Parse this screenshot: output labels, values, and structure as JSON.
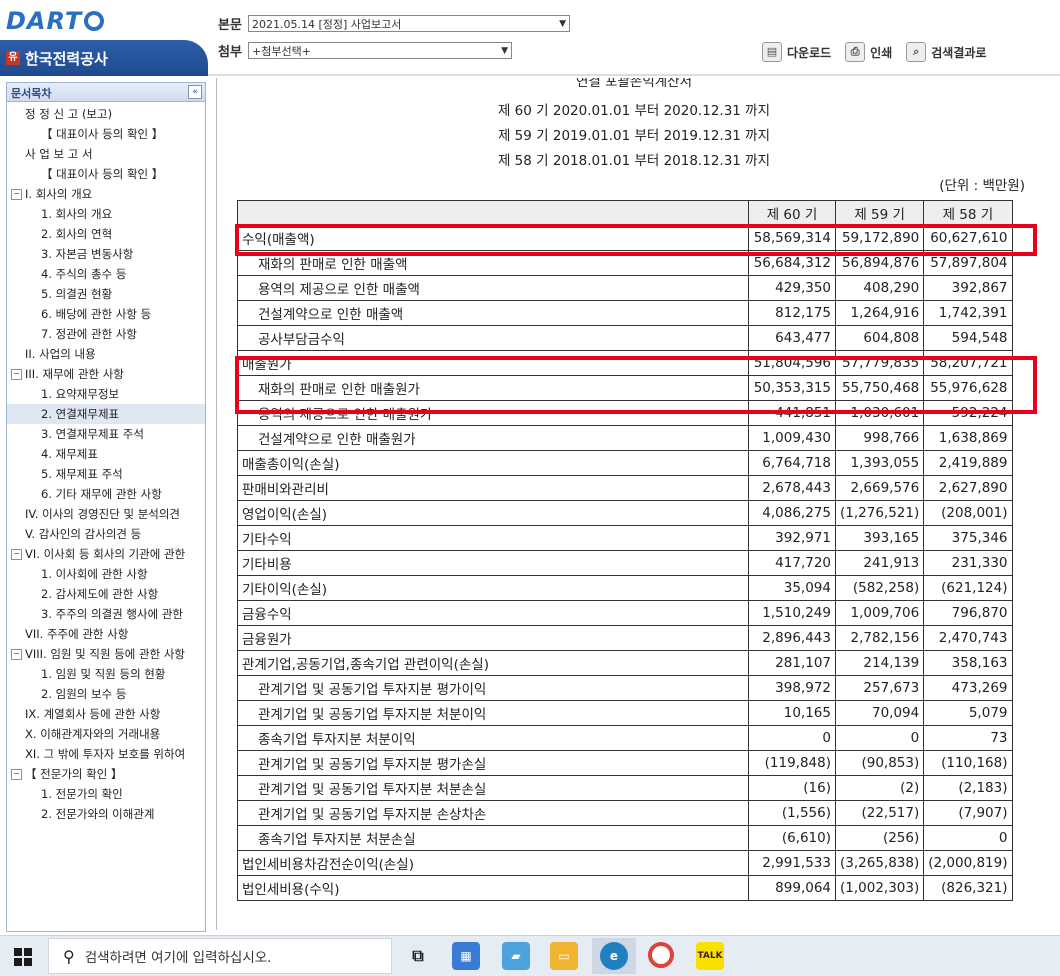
{
  "header": {
    "logo": "DART",
    "company": "한국전력공사",
    "main_label": "본문",
    "main_value": "2021.05.14 [정정] 사업보고서",
    "attach_label": "첨부",
    "attach_value": "+첨부선택+",
    "toolbar": {
      "download": "다운로드",
      "print": "인쇄",
      "search_result": "검색결과로"
    }
  },
  "sidebar": {
    "title": "문서목차",
    "items": [
      {
        "label": "정 정 신 고 (보고)",
        "level": "s"
      },
      {
        "label": "【 대표이사 등의 확인 】",
        "level": "1"
      },
      {
        "label": "사 업 보 고 서",
        "level": "s"
      },
      {
        "label": "【 대표이사 등의 확인 】",
        "level": "1"
      },
      {
        "label": "I. 회사의 개요",
        "level": "0"
      },
      {
        "label": "1. 회사의 개요",
        "level": "1"
      },
      {
        "label": "2. 회사의 연혁",
        "level": "1"
      },
      {
        "label": "3. 자본금 변동사항",
        "level": "1"
      },
      {
        "label": "4. 주식의 총수 등",
        "level": "1"
      },
      {
        "label": "5. 의결권 현황",
        "level": "1"
      },
      {
        "label": "6. 배당에 관한 사항 등",
        "level": "1"
      },
      {
        "label": "7. 정관에 관한 사항",
        "level": "1"
      },
      {
        "label": "II. 사업의 내용",
        "level": "s"
      },
      {
        "label": "III. 재무에 관한 사항",
        "level": "0"
      },
      {
        "label": "1. 요약재무정보",
        "level": "1"
      },
      {
        "label": "2. 연결재무제표",
        "level": "1"
      },
      {
        "label": "3. 연결재무제표 주석",
        "level": "1"
      },
      {
        "label": "4. 재무제표",
        "level": "1"
      },
      {
        "label": "5. 재무제표 주석",
        "level": "1"
      },
      {
        "label": "6. 기타 재무에 관한 사항",
        "level": "1"
      },
      {
        "label": "IV. 이사의 경영진단 및 분석의견",
        "level": "s"
      },
      {
        "label": "V. 감사인의 감사의견 등",
        "level": "s"
      },
      {
        "label": "VI. 이사회 등 회사의 기관에 관한",
        "level": "0"
      },
      {
        "label": "1. 이사회에 관한 사항",
        "level": "1"
      },
      {
        "label": "2. 감사제도에 관한 사항",
        "level": "1"
      },
      {
        "label": "3. 주주의 의결권 행사에 관한",
        "level": "1"
      },
      {
        "label": "VII. 주주에 관한 사항",
        "level": "s"
      },
      {
        "label": "VIII. 임원 및 직원 등에 관한 사항",
        "level": "0"
      },
      {
        "label": "1. 임원 및 직원 등의 현황",
        "level": "1"
      },
      {
        "label": "2. 임원의 보수 등",
        "level": "1"
      },
      {
        "label": "IX. 계열회사 등에 관한 사항",
        "level": "s"
      },
      {
        "label": "X. 이해관계자와의 거래내용",
        "level": "s"
      },
      {
        "label": "XI. 그 밖에 투자자 보호를 위하여",
        "level": "s"
      },
      {
        "label": "【 전문가의 확인 】",
        "level": "0"
      },
      {
        "label": "1. 전문가의 확인",
        "level": "1"
      },
      {
        "label": "2. 전문가와의 이해관계",
        "level": "1"
      }
    ]
  },
  "statement": {
    "title_partial": "연결 포괄손익계산서",
    "periods": [
      "제 60 기 2020.01.01 부터 2020.12.31 까지",
      "제 59 기 2019.01.01 부터 2019.12.31 까지",
      "제 58 기 2018.01.01 부터 2018.12.31 까지"
    ],
    "unit": "(단위 : 백만원)",
    "columns": [
      "",
      "제 60 기",
      "제 59 기",
      "제 58 기"
    ],
    "rows": [
      {
        "label": "수익(매출액)",
        "indent": false,
        "v": [
          "58,569,314",
          "59,172,890",
          "60,627,610"
        ]
      },
      {
        "label": "재화의 판매로 인한 매출액",
        "indent": true,
        "v": [
          "56,684,312",
          "56,894,876",
          "57,897,804"
        ]
      },
      {
        "label": "용역의 제공으로 인한 매출액",
        "indent": true,
        "v": [
          "429,350",
          "408,290",
          "392,867"
        ]
      },
      {
        "label": "건설계약으로 인한 매출액",
        "indent": true,
        "v": [
          "812,175",
          "1,264,916",
          "1,742,391"
        ]
      },
      {
        "label": "공사부담금수익",
        "indent": true,
        "v": [
          "643,477",
          "604,808",
          "594,548"
        ]
      },
      {
        "label": "매출원가",
        "indent": false,
        "v": [
          "51,804,596",
          "57,779,835",
          "58,207,721"
        ]
      },
      {
        "label": "재화의 판매로 인한 매출원가",
        "indent": true,
        "v": [
          "50,353,315",
          "55,750,468",
          "55,976,628"
        ]
      },
      {
        "label": "용역의 제공으로 인한 매출원가",
        "indent": true,
        "v": [
          "441,851",
          "1,030,601",
          "592,224"
        ]
      },
      {
        "label": "건설계약으로 인한 매출원가",
        "indent": true,
        "v": [
          "1,009,430",
          "998,766",
          "1,638,869"
        ]
      },
      {
        "label": "매출총이익(손실)",
        "indent": false,
        "v": [
          "6,764,718",
          "1,393,055",
          "2,419,889"
        ]
      },
      {
        "label": "판매비와관리비",
        "indent": false,
        "v": [
          "2,678,443",
          "2,669,576",
          "2,627,890"
        ]
      },
      {
        "label": "영업이익(손실)",
        "indent": false,
        "v": [
          "4,086,275",
          "(1,276,521)",
          "(208,001)"
        ]
      },
      {
        "label": "기타수익",
        "indent": false,
        "v": [
          "392,971",
          "393,165",
          "375,346"
        ]
      },
      {
        "label": "기타비용",
        "indent": false,
        "v": [
          "417,720",
          "241,913",
          "231,330"
        ]
      },
      {
        "label": "기타이익(손실)",
        "indent": false,
        "v": [
          "35,094",
          "(582,258)",
          "(621,124)"
        ]
      },
      {
        "label": "금융수익",
        "indent": false,
        "v": [
          "1,510,249",
          "1,009,706",
          "796,870"
        ]
      },
      {
        "label": "금융원가",
        "indent": false,
        "v": [
          "2,896,443",
          "2,782,156",
          "2,470,743"
        ]
      },
      {
        "label": "관계기업,공동기업,종속기업 관련이익(손실)",
        "indent": false,
        "v": [
          "281,107",
          "214,139",
          "358,163"
        ]
      },
      {
        "label": "관계기업 및 공동기업 투자지분 평가이익",
        "indent": true,
        "v": [
          "398,972",
          "257,673",
          "473,269"
        ]
      },
      {
        "label": "관계기업 및 공동기업 투자지분 처분이익",
        "indent": true,
        "v": [
          "10,165",
          "70,094",
          "5,079"
        ]
      },
      {
        "label": "종속기업 투자지분 처분이익",
        "indent": true,
        "v": [
          "0",
          "0",
          "73"
        ]
      },
      {
        "label": "관계기업 및 공동기업 투자지분 평가손실",
        "indent": true,
        "v": [
          "(119,848)",
          "(90,853)",
          "(110,168)"
        ]
      },
      {
        "label": "관계기업 및 공동기업 투자지분 처분손실",
        "indent": true,
        "v": [
          "(16)",
          "(2)",
          "(2,183)"
        ]
      },
      {
        "label": "관계기업 및 공동기업 투자지분 손상차손",
        "indent": true,
        "v": [
          "(1,556)",
          "(22,517)",
          "(7,907)"
        ]
      },
      {
        "label": "종속기업 투자지분 처분손실",
        "indent": true,
        "v": [
          "(6,610)",
          "(256)",
          "0"
        ]
      },
      {
        "label": "법인세비용차감전순이익(손실)",
        "indent": false,
        "v": [
          "2,991,533",
          "(3,265,838)",
          "(2,000,819)"
        ]
      },
      {
        "label": "법인세비용(수익)",
        "indent": false,
        "v": [
          "899,064",
          "(1,002,303)",
          "(826,321)"
        ]
      }
    ]
  },
  "taskbar": {
    "search_placeholder": "검색하려면 여기에 입력하십시오."
  },
  "colors": {
    "highlight": "#e8001c",
    "brand_blue": "#2d5ea8"
  }
}
